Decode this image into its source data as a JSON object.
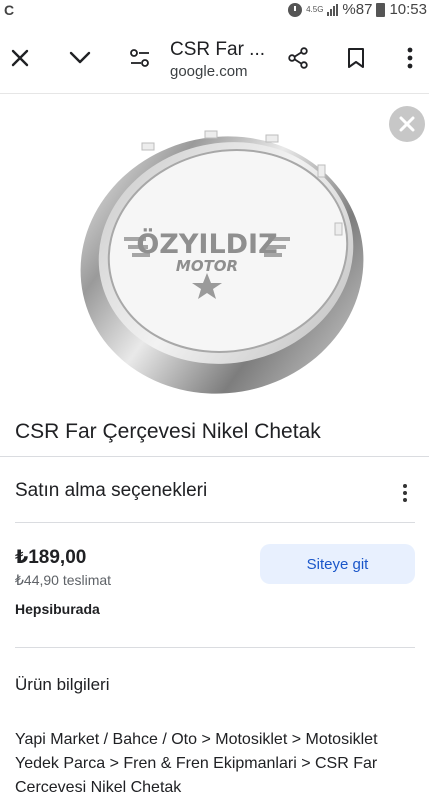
{
  "status_bar": {
    "network": "4.5G",
    "battery_label": "%87",
    "time": "10:53"
  },
  "app_bar": {
    "title": "CSR Far ...",
    "domain": "google.com",
    "icons": [
      "close-icon",
      "chevron-down-icon",
      "tune-icon",
      "share-icon",
      "bookmark-icon",
      "more-vert-icon"
    ]
  },
  "image": {
    "watermark_line1": "ÖZYILDIZ",
    "watermark_line2": "MOTOR"
  },
  "product": {
    "title": "CSR Far Çerçevesi Nikel Chetak"
  },
  "purchase_options": {
    "heading": "Satın alma seçenekleri",
    "offer": {
      "price": "₺189,00",
      "shipping": "₺44,90 teslimat",
      "merchant": "Hepsiburada",
      "cta_label": "Siteye git"
    }
  },
  "product_info": {
    "heading": "Ürün bilgileri",
    "breadcrumb": "Yapi Market / Bahce / Oto > Motosiklet > Motosiklet Yedek Parca > Fren & Fren Ekipmanlari > CSR Far Cercevesi Nikel Chetak"
  }
}
